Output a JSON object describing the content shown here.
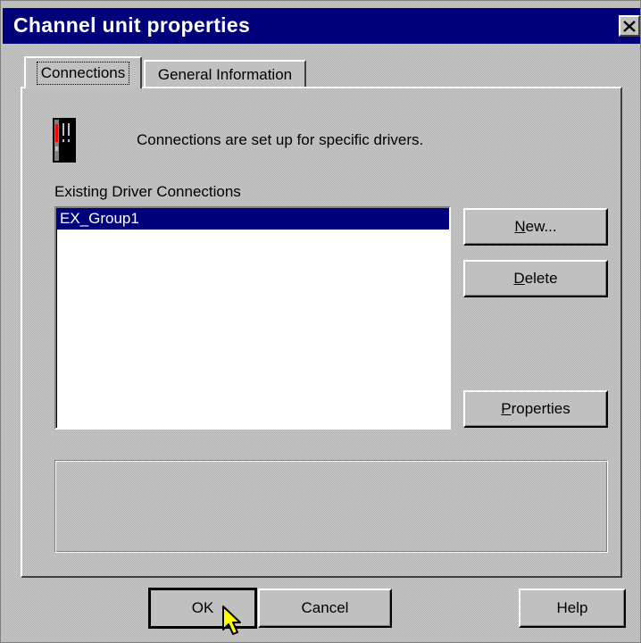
{
  "window": {
    "title": "Channel unit properties",
    "close_icon": "close-icon"
  },
  "tabs": [
    {
      "label": "Connections",
      "active": true
    },
    {
      "label": "General Information",
      "active": false
    }
  ],
  "connections_tab": {
    "device_icon": "channel-unit-icon",
    "info_text": "Connections are set up for specific drivers.",
    "list_label": "Existing Driver Connections",
    "connections": [
      {
        "name": "EX_Group1",
        "selected": true
      }
    ],
    "buttons": {
      "new_mnemonic": "N",
      "new_rest": "ew...",
      "delete_mnemonic": "D",
      "delete_rest": "elete",
      "properties_mnemonic": "P",
      "properties_rest": "roperties"
    },
    "details_text": ""
  },
  "footer": {
    "ok_label": "OK",
    "cancel_label": "Cancel",
    "help_label": "Help"
  },
  "colors": {
    "title_bar": "#00007b",
    "dialog_face": "#c0c0c0",
    "selection": "#00007b"
  }
}
